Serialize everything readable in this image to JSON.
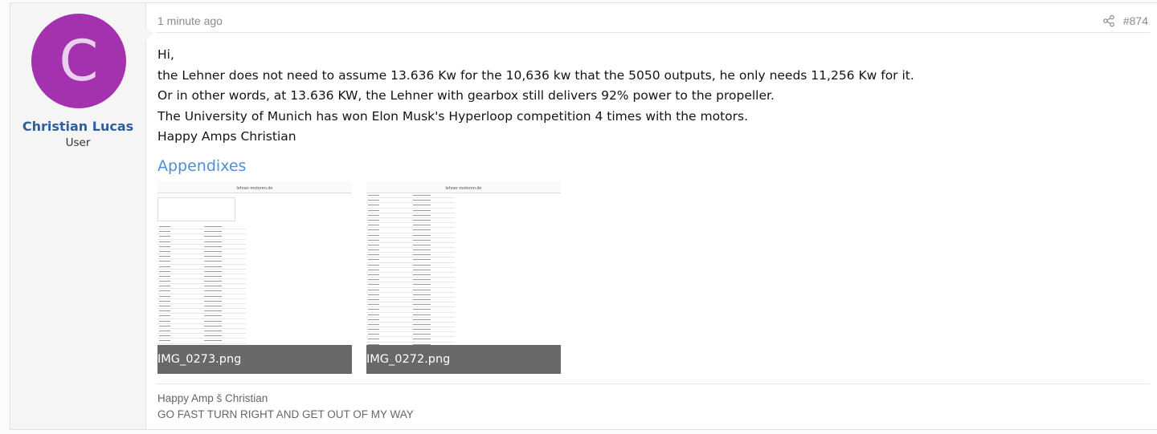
{
  "user": {
    "avatar_letter": "C",
    "avatar_color": "#a431ad",
    "name": "Christian Lucas",
    "title": "User"
  },
  "post": {
    "time": "1 minute ago",
    "number": "#874",
    "share_icon": "share-icon",
    "lines": [
      "Hi,",
      "the Lehner does not need to assume 13.636 Kw for the 10,636 kw that the 5050 outputs, he only needs 11,256 Kw for it.",
      "Or in other words, at 13.636 KW, the Lehner with gearbox still delivers 92% power to the propeller.",
      "The University of Munich has won Elon Musk's Hyperloop competition 4 times with the motors.",
      "Happy Amps Christian"
    ],
    "appendixes_title": "Appendixes",
    "attachments": [
      {
        "filename": "IMG_0273.png",
        "site": "lehner-motoren.de"
      },
      {
        "filename": "IMG_0272.png",
        "site": "lehner-motoren.de"
      }
    ]
  },
  "signature": {
    "line1": "Happy Amp š Christian",
    "line2": "GO FAST TURN RIGHT AND GET OUT OF MY WAY"
  },
  "colors": {
    "username": "#2f5e9e",
    "link": "#4a90d9"
  }
}
